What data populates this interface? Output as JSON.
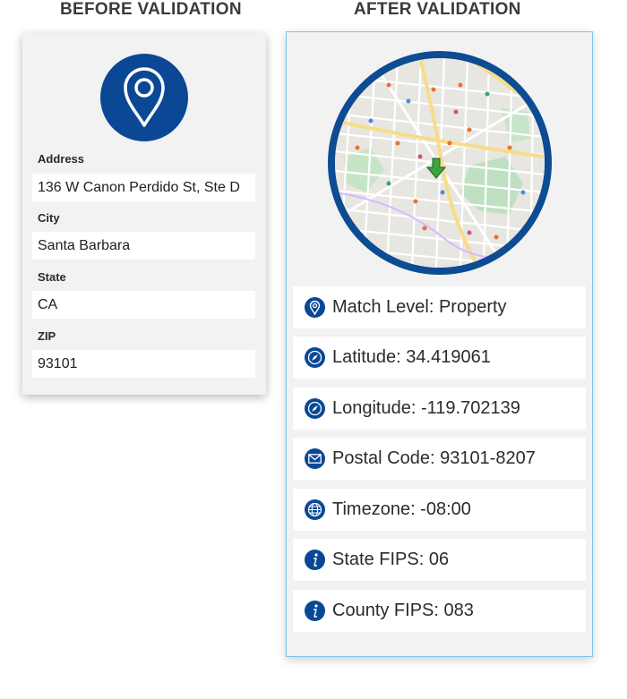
{
  "headings": {
    "before": "BEFORE VALIDATION",
    "after": "AFTER VALIDATION"
  },
  "before": {
    "icon": "location-pin-icon",
    "fields": [
      {
        "label": "Address",
        "value": "136 W Canon Perdido St, Ste D"
      },
      {
        "label": "City",
        "value": "Santa Barbara"
      },
      {
        "label": "State",
        "value": "CA"
      },
      {
        "label": "ZIP",
        "value": "93101"
      }
    ]
  },
  "after": {
    "map": {
      "marker": "map-marker-icon"
    },
    "rows": [
      {
        "icon": "location-pin-icon",
        "text": "Match Level: Property"
      },
      {
        "icon": "compass-icon",
        "text": "Latitude: 34.419061"
      },
      {
        "icon": "compass-icon",
        "text": "Longitude: -119.702139"
      },
      {
        "icon": "envelope-icon",
        "text": "Postal Code: 93101-8207"
      },
      {
        "icon": "globe-icon",
        "text": "Timezone: -08:00"
      },
      {
        "icon": "info-icon",
        "text": "State FIPS: 06"
      },
      {
        "icon": "info-icon",
        "text": "County FIPS: 083"
      }
    ]
  },
  "colors": {
    "brand_blue": "#0a4896",
    "card_bg": "#f2f2f2",
    "after_border": "#7cc4ea",
    "marker_green": "#3aa63a"
  }
}
